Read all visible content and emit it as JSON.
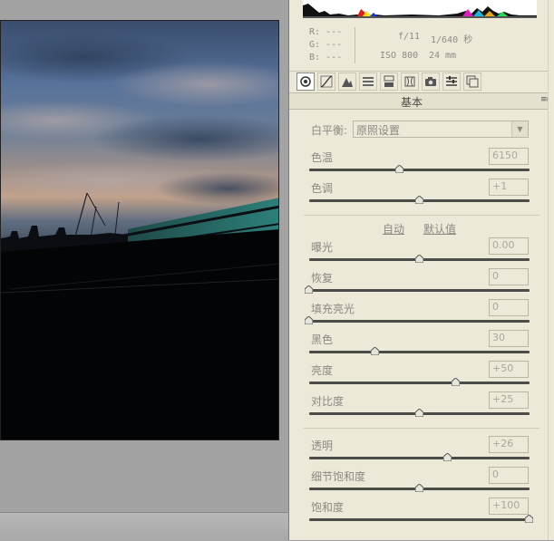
{
  "info": {
    "rgb": [
      "R: ---",
      "G: ---",
      "B: ---"
    ],
    "aperture": "f/11",
    "shutter": "1/640 秒",
    "iso": "ISO 800",
    "focal": "24 mm"
  },
  "tabs": [
    {
      "name": "basic-tab-icon"
    },
    {
      "name": "tone-curve-tab-icon"
    },
    {
      "name": "detail-tab-icon"
    },
    {
      "name": "hsl-tab-icon"
    },
    {
      "name": "split-toning-tab-icon"
    },
    {
      "name": "lens-corrections-tab-icon"
    },
    {
      "name": "camera-calibration-tab-icon"
    },
    {
      "name": "presets-tab-icon"
    },
    {
      "name": "snapshots-tab-icon"
    }
  ],
  "panel": {
    "title": "基本",
    "menu_icon": "≡▸"
  },
  "white_balance": {
    "label": "白平衡:",
    "selected": "原照设置"
  },
  "temp": {
    "label": "色温",
    "value": "6150",
    "position": 0.41
  },
  "tint": {
    "label": "色调",
    "value": "+1",
    "position": 0.5
  },
  "auto_label": "自动",
  "default_label": "默认值",
  "tone_sliders": [
    {
      "label": "曝光",
      "value": "0.00",
      "position": 0.5
    },
    {
      "label": "恢复",
      "value": "0",
      "position": 0.0
    },
    {
      "label": "填充亮光",
      "value": "0",
      "position": 0.0
    },
    {
      "label": "黑色",
      "value": "30",
      "position": 0.3
    },
    {
      "label": "亮度",
      "value": "+50",
      "position": 0.665
    },
    {
      "label": "对比度",
      "value": "+25",
      "position": 0.5
    }
  ],
  "presence_sliders": [
    {
      "label": "透明",
      "value": "+26",
      "position": 0.63
    },
    {
      "label": "细节饱和度",
      "value": "0",
      "position": 0.5
    },
    {
      "label": "饱和度",
      "value": "+100",
      "position": 1.0
    }
  ]
}
